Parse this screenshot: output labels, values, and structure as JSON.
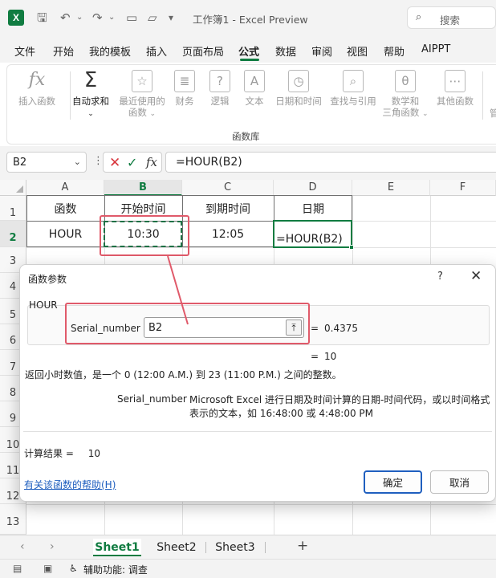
{
  "window": {
    "title": "工作簿1 - Excel Preview",
    "search_placeholder": "搜索",
    "app_icon": "X"
  },
  "menu": {
    "items": [
      "文件",
      "开始",
      "我的模板",
      "插入",
      "页面布局",
      "公式",
      "数据",
      "审阅",
      "视图",
      "帮助",
      "AIPPT"
    ],
    "active": "公式"
  },
  "ribbon": {
    "buttons": [
      {
        "label": "插入函数",
        "icon": "fx-icon"
      },
      {
        "label": "自动求和",
        "icon": "sigma-icon"
      },
      {
        "label": "最近使用的",
        "label2": "函数",
        "icon": "star-icon"
      },
      {
        "label": "财务",
        "icon": "coins-icon"
      },
      {
        "label": "逻辑",
        "icon": "question-icon"
      },
      {
        "label": "文本",
        "icon": "text-a-icon"
      },
      {
        "label": "日期和时间",
        "icon": "clock-icon"
      },
      {
        "label": "查找与引用",
        "icon": "magnifier-icon"
      },
      {
        "label": "数学和",
        "label2": "三角函数",
        "icon": "theta-icon"
      },
      {
        "label": "其他函数",
        "icon": "more-icon"
      }
    ],
    "group_label": "函数库",
    "right_partial": "管"
  },
  "formula_bar": {
    "name_box": "B2",
    "formula": "=HOUR(B2)"
  },
  "grid": {
    "columns": [
      "A",
      "B",
      "C",
      "D",
      "E",
      "F"
    ],
    "rows": [
      "1",
      "2",
      "3",
      "4",
      "5",
      "6",
      "7",
      "8",
      "9",
      "10",
      "11",
      "12",
      "13"
    ],
    "cells": {
      "A1": "函数",
      "B1": "开始时间",
      "C1": "到期时间",
      "D1": "日期",
      "A2": "HOUR",
      "B2": "10:30",
      "C2": "12:05",
      "D2": "=HOUR(B2)"
    }
  },
  "dialog": {
    "title": "函数参数",
    "help": "?",
    "function_name": "HOUR",
    "arg_label": "Serial_number",
    "arg_value": "B2",
    "arg_eval": "0.4375",
    "result_preview": "10",
    "equals": "=",
    "description": "返回小时数值，是一个 0 (12:00 A.M.) 到 23 (11:00 P.M.) 之间的整数。",
    "arg_help_name": "Serial_number",
    "arg_help_text": "Microsoft Excel 进行日期及时间计算的日期-时间代码，或以时间格式表示的文本，如 16:48:00 或 4:48:00 PM",
    "calc_result_label": "计算结果 =",
    "calc_result_value": "10",
    "help_link": "有关该函数的帮助(H)",
    "ok_label": "确定",
    "cancel_label": "取消"
  },
  "sheets": {
    "tabs": [
      "Sheet1",
      "Sheet2",
      "Sheet3"
    ],
    "active": "Sheet1"
  },
  "status": {
    "accessibility": "辅助功能: 调查"
  },
  "colors": {
    "excel_green": "#107c41",
    "highlight_red": "#e05a6a",
    "link_blue": "#1f5fbf"
  }
}
